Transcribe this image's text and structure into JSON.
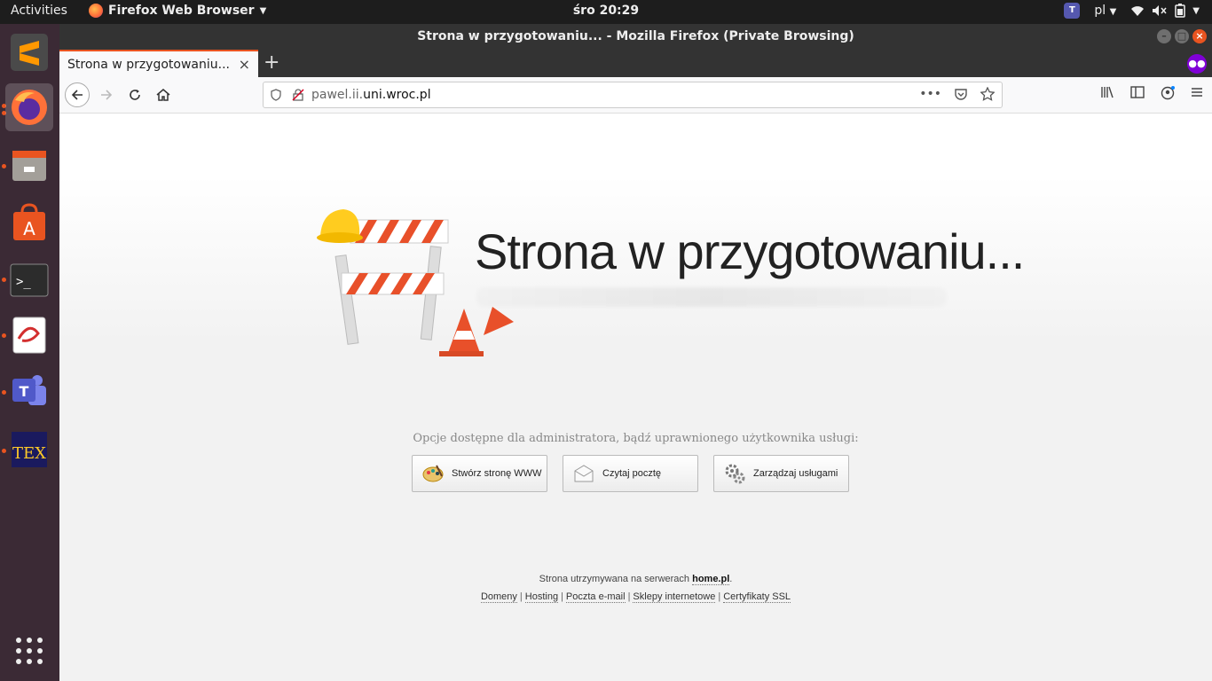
{
  "topbar": {
    "activities": "Activities",
    "app_name": "Firefox Web Browser",
    "clock": "śro 20:29",
    "lang": "pl"
  },
  "dock": {
    "items": [
      "sublime-text",
      "firefox",
      "files",
      "software-center",
      "terminal",
      "document-viewer",
      "teams",
      "texmaker",
      "show-applications"
    ]
  },
  "window": {
    "title": "Strona w przygotowaniu... - Mozilla Firefox (Private Browsing)"
  },
  "tab": {
    "label": "Strona w przygotowaniu..."
  },
  "urlbar": {
    "url_prefix": "pawel.ii.",
    "url_domain": "uni.wroc.pl"
  },
  "page": {
    "hero_title": "Strona w przygotowaniu...",
    "admin_text": "Opcje dostępne dla administratora, bądź uprawnionego użytkownika usługi:",
    "actions": [
      {
        "label": "Stwórz stronę WWW"
      },
      {
        "label": "Czytaj pocztę"
      },
      {
        "label": "Zarządzaj usługami"
      }
    ],
    "footer_text": "Strona utrzymywana na serwerach",
    "brand": "home.pl",
    "footer_links": [
      "Domeny",
      "Hosting",
      "Poczta e-mail",
      "Sklepy internetowe",
      "Certyfikaty SSL"
    ]
  },
  "colors": {
    "accent": "#e95420",
    "dock_bg": "#3b2a35",
    "private": "#8000d7"
  }
}
